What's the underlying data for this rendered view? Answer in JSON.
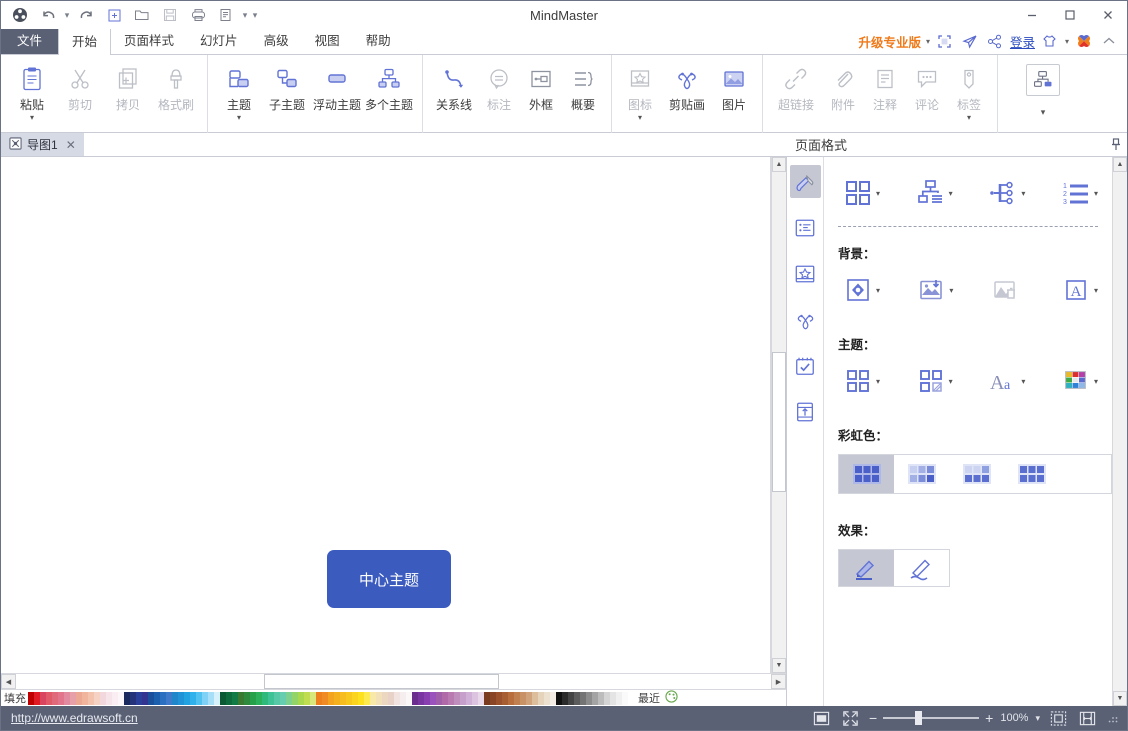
{
  "window": {
    "title": "MindMaster",
    "minimize": "−",
    "maximize": "▢",
    "close": "✕"
  },
  "quick_access": [
    {
      "name": "app-logo-icon",
      "glyph": "✦"
    },
    {
      "name": "undo-icon",
      "glyph": "↺"
    },
    {
      "name": "undo-dropdown-icon",
      "glyph": "▾"
    },
    {
      "name": "redo-icon",
      "glyph": "↻"
    },
    {
      "name": "new-icon",
      "glyph": "＋"
    },
    {
      "name": "open-icon",
      "glyph": "📂"
    },
    {
      "name": "save-icon",
      "glyph": "▤"
    },
    {
      "name": "print-icon",
      "glyph": "🖨"
    },
    {
      "name": "export-icon",
      "glyph": "▤"
    },
    {
      "name": "export-dropdown-icon",
      "glyph": "▾"
    },
    {
      "name": "customize-qat-icon",
      "glyph": "▾"
    }
  ],
  "menu": {
    "tabs": [
      {
        "label": "文件",
        "kind": "file"
      },
      {
        "label": "开始",
        "kind": "active"
      },
      {
        "label": "页面样式",
        "kind": "normal"
      },
      {
        "label": "幻灯片",
        "kind": "normal"
      },
      {
        "label": "高级",
        "kind": "normal"
      },
      {
        "label": "视图",
        "kind": "normal"
      },
      {
        "label": "帮助",
        "kind": "normal"
      }
    ],
    "upgrade_label": "升级专业版",
    "login_label": "登录",
    "right_icons": [
      {
        "name": "fullscreen-icon"
      },
      {
        "name": "send-icon"
      },
      {
        "name": "share-icon"
      },
      {
        "name": "theme-shirt-icon"
      },
      {
        "name": "edraw-logo-icon"
      },
      {
        "name": "collapse-ribbon-icon"
      }
    ]
  },
  "ribbon": {
    "groups": [
      {
        "name": "clipboard",
        "items": [
          {
            "label": "粘贴",
            "icon": "paste-icon",
            "disabled": false,
            "dropdown": true
          },
          {
            "label": "剪切",
            "icon": "cut-icon",
            "disabled": true,
            "dropdown": false
          },
          {
            "label": "拷贝",
            "icon": "copy-icon",
            "disabled": true,
            "dropdown": false
          },
          {
            "label": "格式刷",
            "icon": "format-painter-icon",
            "disabled": true,
            "dropdown": false
          }
        ]
      },
      {
        "name": "topics",
        "items": [
          {
            "label": "主题",
            "icon": "topic-icon",
            "disabled": false,
            "dropdown": true
          },
          {
            "label": "子主题",
            "icon": "subtopic-icon",
            "disabled": false,
            "dropdown": false
          },
          {
            "label": "浮动主题",
            "icon": "floating-topic-icon",
            "disabled": false,
            "dropdown": false
          },
          {
            "label": "多个主题",
            "icon": "multiple-topics-icon",
            "disabled": false,
            "dropdown": false
          }
        ]
      },
      {
        "name": "relations",
        "items": [
          {
            "label": "关系线",
            "icon": "relationship-line-icon",
            "disabled": false,
            "dropdown": false
          },
          {
            "label": "标注",
            "icon": "callout-icon",
            "disabled": true,
            "dropdown": false
          },
          {
            "label": "外框",
            "icon": "boundary-icon",
            "disabled": false,
            "dropdown": false
          },
          {
            "label": "概要",
            "icon": "summary-icon",
            "disabled": false,
            "dropdown": false
          }
        ]
      },
      {
        "name": "media",
        "items": [
          {
            "label": "图标",
            "icon": "marker-icon",
            "disabled": true,
            "dropdown": true
          },
          {
            "label": "剪贴画",
            "icon": "clipart-icon",
            "disabled": false,
            "dropdown": false
          },
          {
            "label": "图片",
            "icon": "picture-icon",
            "disabled": false,
            "dropdown": false
          }
        ]
      },
      {
        "name": "annotations",
        "items": [
          {
            "label": "超链接",
            "icon": "hyperlink-icon",
            "disabled": true,
            "dropdown": false
          },
          {
            "label": "附件",
            "icon": "attachment-icon",
            "disabled": true,
            "dropdown": false
          },
          {
            "label": "注释",
            "icon": "note-icon",
            "disabled": true,
            "dropdown": false
          },
          {
            "label": "评论",
            "icon": "comment-icon",
            "disabled": true,
            "dropdown": false
          },
          {
            "label": "标签",
            "icon": "tag-icon",
            "disabled": true,
            "dropdown": true
          }
        ]
      },
      {
        "name": "layout",
        "items": [
          {
            "label": "",
            "icon": "layout-structure-icon",
            "disabled": false,
            "dropdown": true,
            "boxed": true
          }
        ]
      }
    ]
  },
  "doc_tabs": [
    {
      "label": "导图1",
      "icon": "mindmap-doc-icon",
      "close": "✕"
    }
  ],
  "canvas": {
    "center_topic": "中心主题"
  },
  "panel": {
    "title": "页面格式",
    "pin_icon": "pin-icon",
    "side_tabs": [
      {
        "name": "page-format-tab",
        "icon": "paint-brush-icon",
        "selected": true
      },
      {
        "name": "outline-tab",
        "icon": "list-icon",
        "selected": false
      },
      {
        "name": "icon-library-tab",
        "icon": "star-card-icon",
        "selected": false
      },
      {
        "name": "clipart-tab",
        "icon": "clover-icon",
        "selected": false
      },
      {
        "name": "task-tab",
        "icon": "task-checkbox-icon",
        "selected": false
      },
      {
        "name": "insert-tab",
        "icon": "insert-slide-icon",
        "selected": false
      }
    ],
    "layout_row": [
      {
        "name": "layout-style-button",
        "icon": "grid-layout-icon",
        "dropdown": true
      },
      {
        "name": "structure-button",
        "icon": "org-structure-icon",
        "dropdown": true
      },
      {
        "name": "branch-structure-button",
        "icon": "branch-structure-icon",
        "dropdown": true
      },
      {
        "name": "numbering-button",
        "icon": "numbering-icon",
        "dropdown": true
      }
    ],
    "background": {
      "label": "背景：",
      "items": [
        {
          "name": "background-fill-button",
          "icon": "fill-bucket-icon",
          "dropdown": true,
          "disabled": false
        },
        {
          "name": "background-image-button",
          "icon": "image-insert-icon",
          "dropdown": true,
          "disabled": false
        },
        {
          "name": "remove-background-image-button",
          "icon": "image-delete-icon",
          "dropdown": false,
          "disabled": true
        },
        {
          "name": "watermark-button",
          "icon": "watermark-a-icon",
          "dropdown": true,
          "disabled": false
        }
      ]
    },
    "theme": {
      "label": "主题：",
      "items": [
        {
          "name": "theme-style-button",
          "icon": "grid-theme-icon",
          "dropdown": true,
          "disabled": false
        },
        {
          "name": "theme-variant-button",
          "icon": "grid-variant-icon",
          "dropdown": true,
          "disabled": false
        },
        {
          "name": "theme-font-button",
          "icon": "font-aa-icon",
          "dropdown": true,
          "disabled": false
        },
        {
          "name": "theme-color-button",
          "icon": "color-palette-grid-icon",
          "dropdown": true,
          "disabled": false
        }
      ]
    },
    "rainbow": {
      "label": "彩虹色：",
      "options": [
        {
          "name": "rainbow-option-1",
          "selected": true
        },
        {
          "name": "rainbow-option-2",
          "selected": false
        },
        {
          "name": "rainbow-option-3",
          "selected": false
        },
        {
          "name": "rainbow-option-4",
          "selected": false
        }
      ]
    },
    "effect": {
      "label": "效果：",
      "options": [
        {
          "name": "effect-straight-pen",
          "icon": "pen-straight-icon",
          "selected": true
        },
        {
          "name": "effect-wavy-pen",
          "icon": "pen-wavy-icon",
          "selected": false
        }
      ]
    }
  },
  "palette": {
    "fill_label": "填充",
    "recent_label": "最近",
    "more_icon": "color-wheel-icon",
    "colors": [
      "#c00000",
      "#e01b24",
      "#d9455f",
      "#e05a6a",
      "#e06a7a",
      "#e2758c",
      "#e18aa0",
      "#e8a0a8",
      "#eda894",
      "#f0b59c",
      "#f3c3ad",
      "#f5d2c3",
      "#f2d8dd",
      "#f7e3ea",
      "#fbeef2",
      "#fdf6f8",
      "#1b2a5e",
      "#24337a",
      "#2a3f9a",
      "#33348f",
      "#1a4f9c",
      "#1b5fae",
      "#2a6fc0",
      "#3f79c9",
      "#1f86cc",
      "#1f93d6",
      "#22a2e0",
      "#2fb2ec",
      "#4fc2f2",
      "#7fd2f6",
      "#a8dff8",
      "#d6f0fc",
      "#0b5a33",
      "#0d6b3c",
      "#127a45",
      "#3a7a30",
      "#2f8a3d",
      "#27a04a",
      "#2cb05a",
      "#2fb97a",
      "#3fc295",
      "#57c9a6",
      "#66cdb0",
      "#7ed08f",
      "#93d468",
      "#a9d84f",
      "#c0dd52",
      "#d8e77c",
      "#ee7f1f",
      "#f08a22",
      "#f3a31f",
      "#f5b01f",
      "#f7bd1f",
      "#f9c81f",
      "#fbd41f",
      "#fde11f",
      "#fdea4f",
      "#f8e9a8",
      "#f2e0b8",
      "#ecd7c0",
      "#e8d2c8",
      "#f0e3e0",
      "#f6eeee",
      "#fbf7f7",
      "#6b2d8e",
      "#7a35a0",
      "#8a3fb0",
      "#9a52bc",
      "#a05fa8",
      "#b06aa8",
      "#b87ab0",
      "#c08ebc",
      "#c79fcb",
      "#d0b0d6",
      "#dcc3e0",
      "#e8d8ea",
      "#7a3a1f",
      "#8a4426",
      "#9a512c",
      "#a85e33",
      "#b86f3d",
      "#c18050",
      "#c89166",
      "#d0a37c",
      "#dcbd9c",
      "#e6d3bb",
      "#ece0cf",
      "#f2ece4",
      "#111111",
      "#2b2b2b",
      "#444444",
      "#5c5c5c",
      "#747474",
      "#8c8c8c",
      "#a4a4a4",
      "#bcbcbc",
      "#d4d4d4",
      "#e4e4e4",
      "#f0f0f0",
      "#fafafa"
    ]
  },
  "status": {
    "url": "http://www.edrawsoft.cn",
    "zoom_label": "100%",
    "icons": [
      {
        "name": "fit-page-icon"
      },
      {
        "name": "fit-window-icon"
      },
      {
        "name": "zoom-out-icon",
        "glyph": "−"
      },
      {
        "name": "zoom-in-icon",
        "glyph": "+"
      },
      {
        "name": "zoom-dropdown-icon",
        "glyph": "▾"
      },
      {
        "name": "selection-mode-icon"
      },
      {
        "name": "page-layout-icon"
      }
    ]
  }
}
